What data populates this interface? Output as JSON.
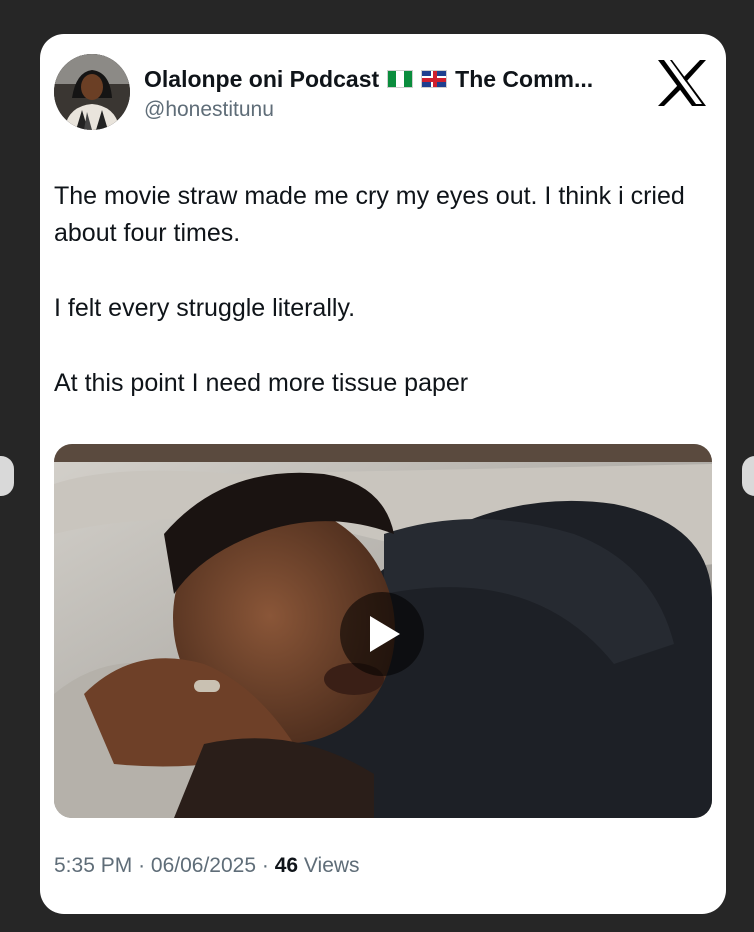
{
  "post": {
    "display_name": "Olalonpe oni Podcast",
    "name_suffix": "The Comm...",
    "handle": "@honestitunu",
    "paragraphs": [
      "The movie straw made me cry my eyes out. I think i cried about four times.",
      "I felt every struggle literally.",
      "At this point I need more tissue paper"
    ],
    "timestamp": "5:35 PM",
    "separator": "·",
    "date": "06/06/2025",
    "views_count": "46",
    "views_label": "Views"
  },
  "icons": {
    "platform_logo": "x-logo-icon",
    "flags": [
      "nigeria-flag-icon",
      "uk-flag-icon"
    ],
    "media_control": "play-icon"
  },
  "colors": {
    "background": "#262626",
    "card": "#ffffff",
    "text_primary": "#0f1419",
    "text_secondary": "#5f6d78"
  }
}
